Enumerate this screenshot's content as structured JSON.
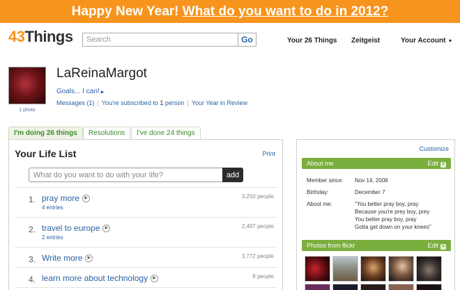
{
  "banner": {
    "prefix": "Happy New Year!",
    "link": "What do you want to do in 2012?"
  },
  "logo": {
    "number": "43",
    "word": "Things"
  },
  "search": {
    "placeholder": "Search",
    "button": "Go"
  },
  "nav": {
    "things": "Your 26 Things",
    "zeitgeist": "Zeitgeist",
    "account": "Your Account"
  },
  "profile": {
    "username": "LaReinaMargot",
    "avatar_caption": "1 photo",
    "goals_link": "Goals... I can!",
    "messages_label": "Messages",
    "messages_count": "(1)",
    "subscribed_prefix": "You're subscribed to",
    "subscribed_count": "1",
    "subscribed_suffix": "person",
    "year_review": "Your Year in Review"
  },
  "tabs": [
    {
      "label": "I'm doing 26 things",
      "active": true
    },
    {
      "label": "Resolutions",
      "active": false
    },
    {
      "label": "I've done 24 things",
      "active": false
    }
  ],
  "life_list": {
    "title": "Your Life List",
    "print": "Print",
    "input_placeholder": "What do you want to do with your life?",
    "add_button": "add",
    "items": [
      {
        "index": "1.",
        "title": "pray more",
        "entries": "4 entries",
        "people": "3,250 people"
      },
      {
        "index": "2.",
        "title": "travel to europe",
        "entries": "2 entries",
        "people": "2,497 people"
      },
      {
        "index": "3.",
        "title": "Write more",
        "entries": "",
        "people": "3,772 people"
      },
      {
        "index": "4.",
        "title": "learn more about technology",
        "entries": "",
        "people": "8 people"
      }
    ]
  },
  "sidebar": {
    "customize": "Customize",
    "about": {
      "title": "About me",
      "edit": "Edit",
      "member_since_label": "Member since:",
      "member_since": "Nov 14, 2008",
      "birthday_label": "Birthday:",
      "birthday": "December 7",
      "about_label": "About me:",
      "quote": [
        "\"You better pray boy, pray",
        "Because you're prey boy, prey",
        "You better pray boy, pray",
        "Gotta get down on your knees\""
      ]
    },
    "photos": {
      "title": "Photos from flickr",
      "edit": "Edit"
    }
  },
  "colors": {
    "banner": "#f7941d",
    "link": "#2a62a6",
    "green": "#7aae3d"
  }
}
